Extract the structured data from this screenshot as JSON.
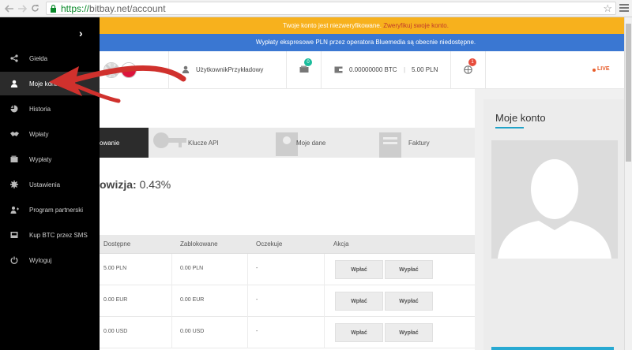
{
  "browser": {
    "url_scheme": "https://",
    "url_rest": "bitbay.net/account",
    "back_icon": "arrow-left-icon",
    "forward_icon": "arrow-right-icon",
    "reload_icon": "reload-icon"
  },
  "sidebar": {
    "toggle_icon": "chevron-right-icon",
    "items": [
      {
        "label": "Giełda",
        "icon": "share-icon"
      },
      {
        "label": "Moje konto",
        "icon": "user-icon",
        "active": true
      },
      {
        "label": "Historia",
        "icon": "pie-chart-icon"
      },
      {
        "label": "Wpłaty",
        "icon": "handshake-icon"
      },
      {
        "label": "Wypłaty",
        "icon": "wallet-icon"
      },
      {
        "label": "Ustawienia",
        "icon": "gear-icon"
      },
      {
        "label": "Program partnerski",
        "icon": "partners-icon"
      },
      {
        "label": "Kup BTC przez SMS",
        "icon": "phone-icon"
      },
      {
        "label": "Wyloguj",
        "icon": "power-icon"
      }
    ]
  },
  "banners": {
    "warning_text": "Twoje konto jest niezweryfikowane.",
    "warning_link": "Zweryfikuj swoje konto.",
    "info_text": "Wypłaty ekspresowe PLN przez operatora Bluemedia są obecnie niedostępne."
  },
  "topbar": {
    "username": "UżytkownikPrzykładowy",
    "wallet_badge": "0",
    "btc_balance": "0.00000000 BTC",
    "separator": "|",
    "pln_balance": "5.00 PLN",
    "notif_badge": "1",
    "live_label": "LIVE",
    "colors": {
      "teal": "#1abc9c",
      "red": "#e74c3c",
      "live": "#e85c2a"
    }
  },
  "tabs": [
    {
      "label": "owanie",
      "active": true
    },
    {
      "label": "Klucze API"
    },
    {
      "label": "Moje dane"
    },
    {
      "label": "Faktury"
    }
  ],
  "commission": {
    "label": "owizja:",
    "value": "0.43%"
  },
  "table": {
    "headers": [
      "Dostępne",
      "Zablokowane",
      "Oczekuje",
      "Akcja"
    ],
    "rows": [
      {
        "available": "5.00 PLN",
        "blocked": "0.00 PLN",
        "pending": "-",
        "deposit": "Wpłać",
        "withdraw": "Wypłać"
      },
      {
        "available": "0.00 EUR",
        "blocked": "0.00 EUR",
        "pending": "-",
        "deposit": "Wpłać",
        "withdraw": "Wypłać"
      },
      {
        "available": "0.00 USD",
        "blocked": "0.00 USD",
        "pending": "-",
        "deposit": "Wpłać",
        "withdraw": "Wypłać"
      }
    ]
  },
  "right_panel": {
    "title": "Moje konto"
  },
  "colors": {
    "sidebar_bg": "#000000",
    "warning": "#f7b11d",
    "info": "#3a77d2",
    "accent": "#1fa2c8",
    "arrow": "#d0312d"
  }
}
